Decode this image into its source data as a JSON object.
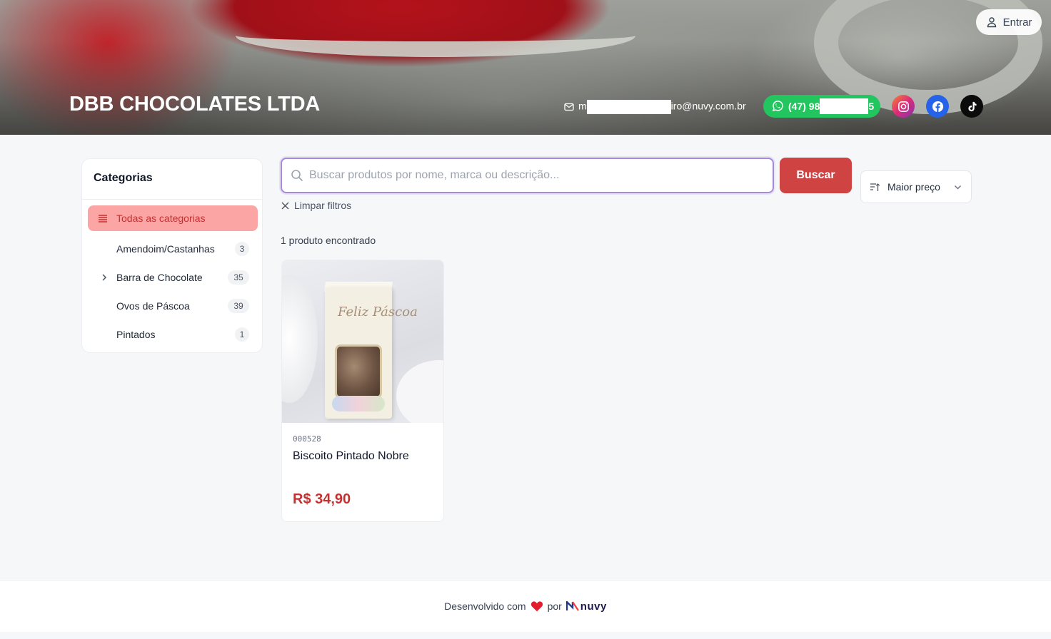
{
  "header": {
    "store_name": "DBB CHOCOLATES LTDA",
    "login_label": "Entrar",
    "email_prefix": "m",
    "email_suffix": "iro@nuvy.com.br",
    "whatsapp_prefix": "(47) 98",
    "whatsapp_suffix": "5",
    "social": [
      "instagram-icon",
      "facebook-icon",
      "tiktok-icon"
    ]
  },
  "sidebar": {
    "title": "Categorias",
    "all_label": "Todas as categorias",
    "items": [
      {
        "label": "Amendoim/Castanhas",
        "count": "3",
        "expandable": false
      },
      {
        "label": "Barra de Chocolate",
        "count": "35",
        "expandable": true
      },
      {
        "label": "Ovos de Páscoa",
        "count": "39",
        "expandable": false
      },
      {
        "label": "Pintados",
        "count": "1",
        "expandable": false
      }
    ]
  },
  "search": {
    "placeholder": "Buscar produtos por nome, marca ou descrição...",
    "value": "",
    "button_label": "Buscar"
  },
  "sort": {
    "selected": "Maior preço"
  },
  "filters": {
    "clear_label": "Limpar filtros",
    "result_count": "1 produto encontrado"
  },
  "products": [
    {
      "code": "000528",
      "name": "Biscoito Pintado Nobre",
      "price": "R$ 34,90",
      "image_text": "Feliz Páscoa"
    }
  ],
  "footer": {
    "made_with": "Desenvolvido com",
    "by": "por",
    "brand": "nuvy"
  },
  "colors": {
    "accent": "#cf4343",
    "active_category_bg": "#fca5a5",
    "price": "#c53030",
    "whatsapp": "#22c55e",
    "facebook": "#2563eb"
  }
}
